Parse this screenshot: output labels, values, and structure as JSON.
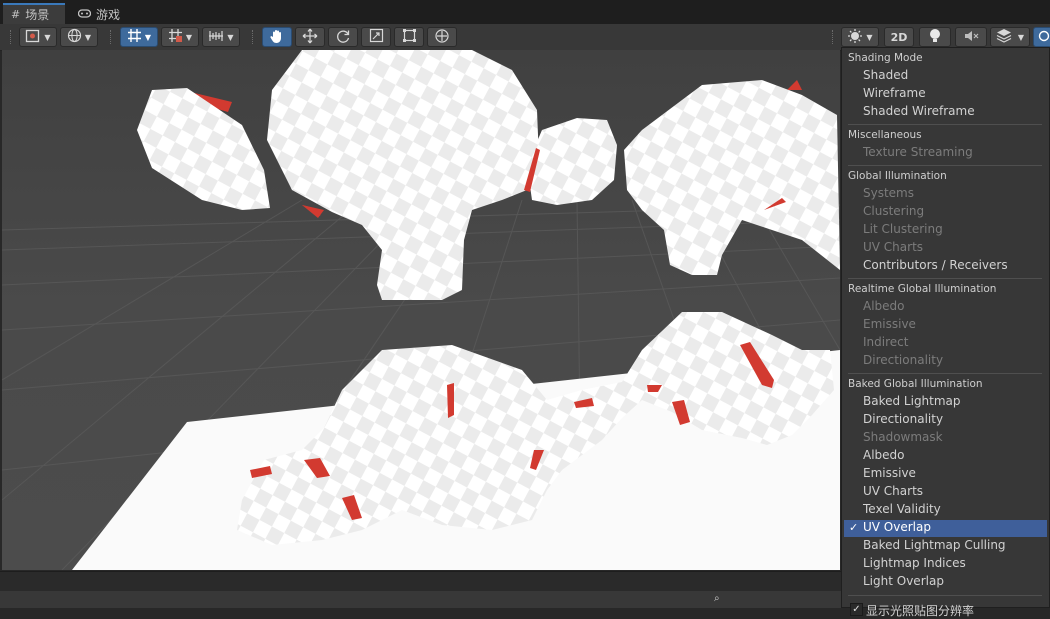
{
  "tabs": [
    {
      "label": "场景",
      "icon": "grid-icon",
      "active": true
    },
    {
      "label": "游戏",
      "icon": "gamepad-icon",
      "active": false
    }
  ],
  "toolbar": {
    "mode_2d_label": "2D",
    "right_tools": [
      "render-mode-icon",
      "2d-toggle",
      "lighting-icon",
      "audio-mute-icon",
      "effects-icon",
      "gizmos-icon"
    ],
    "transform_tools": [
      "hand-icon",
      "move-icon",
      "rotate-icon",
      "scale-icon",
      "rect-icon",
      "transform-icon"
    ],
    "left_tools": [
      "draw-mode-icon",
      "globe-icon",
      "grid-snap-icon",
      "increment-snap-icon",
      "ruler-icon"
    ]
  },
  "menu": {
    "sections": [
      {
        "header": "Shading Mode",
        "items": [
          {
            "label": "Shaded",
            "enabled": true
          },
          {
            "label": "Wireframe",
            "enabled": true
          },
          {
            "label": "Shaded Wireframe",
            "enabled": true
          }
        ]
      },
      {
        "header": "Miscellaneous",
        "items": [
          {
            "label": "Texture Streaming",
            "enabled": false
          }
        ]
      },
      {
        "header": "Global Illumination",
        "items": [
          {
            "label": "Systems",
            "enabled": false
          },
          {
            "label": "Clustering",
            "enabled": false
          },
          {
            "label": "Lit Clustering",
            "enabled": false
          },
          {
            "label": "UV Charts",
            "enabled": false
          },
          {
            "label": "Contributors / Receivers",
            "enabled": true
          }
        ]
      },
      {
        "header": "Realtime Global Illumination",
        "items": [
          {
            "label": "Albedo",
            "enabled": false
          },
          {
            "label": "Emissive",
            "enabled": false
          },
          {
            "label": "Indirect",
            "enabled": false
          },
          {
            "label": "Directionality",
            "enabled": false
          }
        ]
      },
      {
        "header": "Baked Global Illumination",
        "items": [
          {
            "label": "Baked Lightmap",
            "enabled": true
          },
          {
            "label": "Directionality",
            "enabled": true
          },
          {
            "label": "Shadowmask",
            "enabled": false
          },
          {
            "label": "Albedo",
            "enabled": true
          },
          {
            "label": "Emissive",
            "enabled": true
          },
          {
            "label": "UV Charts",
            "enabled": true
          },
          {
            "label": "Texel Validity",
            "enabled": true
          },
          {
            "label": "UV Overlap",
            "enabled": true,
            "checked": true
          },
          {
            "label": "Baked Lightmap Culling",
            "enabled": true
          },
          {
            "label": "Lightmap Indices",
            "enabled": true
          },
          {
            "label": "Light Overlap",
            "enabled": true
          }
        ]
      }
    ],
    "checkmark": "✓",
    "footer_checkbox": {
      "label": "显示光照贴图分辨率",
      "checked": true
    }
  },
  "colors": {
    "accent": "#3e6a9c",
    "selection": "#3f5f9a",
    "overlap_red": "#d23a30",
    "checker_light": "#ffffff",
    "checker_dark": "#ececec"
  }
}
